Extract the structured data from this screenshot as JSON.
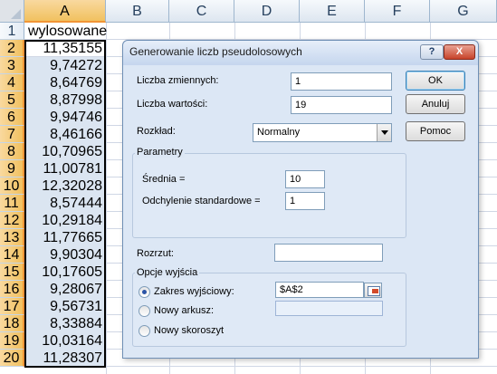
{
  "sheet": {
    "columns": [
      "A",
      "B",
      "C",
      "D",
      "E",
      "F",
      "G"
    ],
    "rows": [
      "1",
      "2",
      "3",
      "4",
      "5",
      "6",
      "7",
      "8",
      "9",
      "10",
      "11",
      "12",
      "13",
      "14",
      "15",
      "16",
      "17",
      "18",
      "19",
      "20"
    ],
    "header_cell": "wylosowane",
    "values": [
      "11,35155",
      "9,74272",
      "8,64769",
      "8,87998",
      "9,94746",
      "8,46166",
      "10,70965",
      "11,00781",
      "12,32028",
      "8,57444",
      "10,29184",
      "11,77665",
      "9,90304",
      "10,17605",
      "9,28067",
      "9,56731",
      "8,33884",
      "10,03164",
      "11,28307"
    ]
  },
  "dialog": {
    "title": "Generowanie liczb pseudolosowych",
    "help_label": "?",
    "close_label": "X",
    "num_vars_label": "Liczba zmiennych:",
    "num_vars_value": "1",
    "num_values_label": "Liczba wartości:",
    "num_values_value": "19",
    "distribution_label": "Rozkład:",
    "distribution_value": "Normalny",
    "params_title": "Parametry",
    "mean_label": "Średnia =",
    "mean_value": "10",
    "stddev_label": "Odchylenie standardowe =",
    "stddev_value": "1",
    "seed_label": "Rozrzut:",
    "seed_value": "",
    "output_title": "Opcje wyjścia",
    "output_range_label": "Zakres wyjściowy:",
    "output_range_value": "$A$2",
    "new_sheet_label": "Nowy arkusz:",
    "new_workbook_label": "Nowy skoroszyt",
    "ok_label": "OK",
    "cancel_label": "Anuluj",
    "help_button_label": "Pomoc"
  }
}
